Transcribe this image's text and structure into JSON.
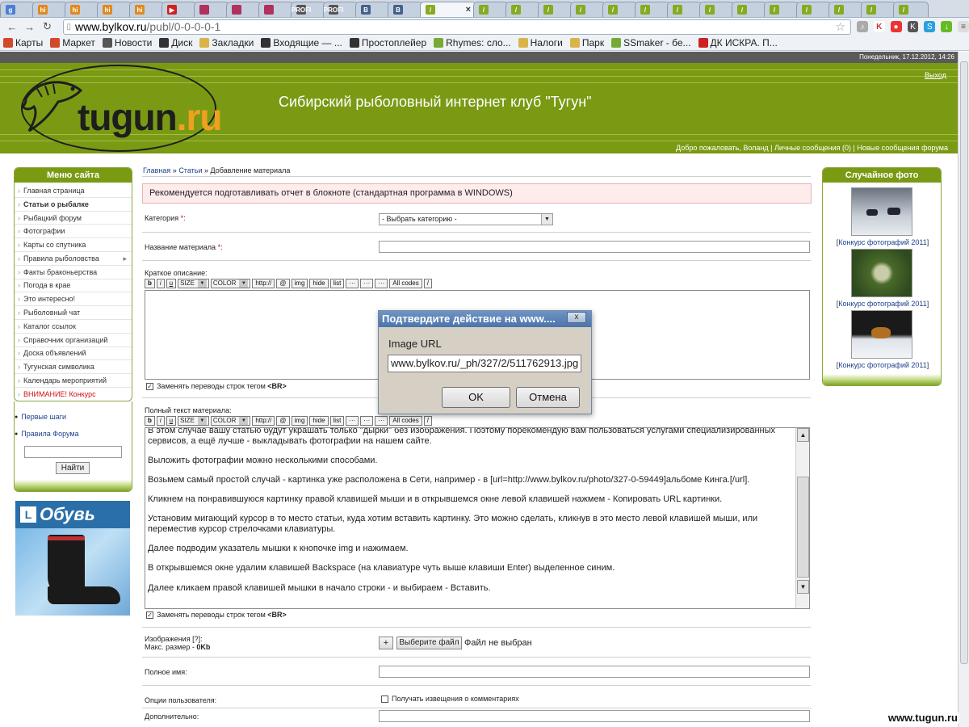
{
  "browser": {
    "tabs": [
      {
        "favicon": "google-icon",
        "label": "g",
        "color": "#4a7fd4"
      },
      {
        "favicon": "hi-icon",
        "label": "hi",
        "color": "#e08a1e"
      },
      {
        "favicon": "hi-icon",
        "label": "hi",
        "color": "#e08a1e"
      },
      {
        "favicon": "hi-icon",
        "label": "hi",
        "color": "#e08a1e"
      },
      {
        "favicon": "hi-icon",
        "label": "hi",
        "color": "#e08a1e"
      },
      {
        "favicon": "youtube-icon",
        "label": "▶",
        "color": "#cc2222"
      },
      {
        "favicon": "page-icon",
        "label": "",
        "color": "#b03060"
      },
      {
        "favicon": "page-icon",
        "label": "",
        "color": "#b03060"
      },
      {
        "favicon": "page-icon",
        "label": "",
        "color": "#b03060"
      },
      {
        "favicon": "profi-icon",
        "label": "PROFI",
        "color": "#555"
      },
      {
        "favicon": "profi-icon",
        "label": "PROFI",
        "color": "#555"
      },
      {
        "favicon": "vk-icon",
        "label": "B",
        "color": "#44618c"
      },
      {
        "favicon": "vk-icon",
        "label": "B",
        "color": "#44618c"
      },
      {
        "favicon": "feather-icon",
        "label": "/",
        "color": "#88aa22",
        "active": true
      },
      {
        "favicon": "feather-icon",
        "label": "/",
        "color": "#88aa22"
      },
      {
        "favicon": "feather-icon",
        "label": "/",
        "color": "#88aa22"
      },
      {
        "favicon": "feather-icon",
        "label": "/",
        "color": "#88aa22"
      },
      {
        "favicon": "feather-icon",
        "label": "/",
        "color": "#88aa22"
      },
      {
        "favicon": "feather-icon",
        "label": "/",
        "color": "#88aa22"
      },
      {
        "favicon": "feather-icon",
        "label": "/",
        "color": "#88aa22"
      },
      {
        "favicon": "feather-icon",
        "label": "/",
        "color": "#88aa22"
      },
      {
        "favicon": "feather-icon",
        "label": "/",
        "color": "#88aa22"
      },
      {
        "favicon": "feather-icon",
        "label": "/",
        "color": "#88aa22"
      },
      {
        "favicon": "feather-icon",
        "label": "/",
        "color": "#88aa22"
      },
      {
        "favicon": "feather-icon",
        "label": "/",
        "color": "#88aa22"
      },
      {
        "favicon": "feather-icon",
        "label": "/",
        "color": "#88aa22"
      },
      {
        "favicon": "feather-icon",
        "label": "/",
        "color": "#88aa22"
      },
      {
        "favicon": "feather-icon",
        "label": "/",
        "color": "#88aa22"
      }
    ],
    "url_domain": "www.bylkov.ru",
    "url_path": "/publ/0-0-0-0-1",
    "bookmarks": [
      {
        "icon": "map-icon",
        "label": "Карты",
        "color": "#d24a2a"
      },
      {
        "icon": "market-icon",
        "label": "Маркет",
        "color": "#d24a2a"
      },
      {
        "icon": "news-icon",
        "label": "Новости",
        "color": "#555"
      },
      {
        "icon": "disk-icon",
        "label": "Диск",
        "color": "#333"
      },
      {
        "icon": "folder-icon",
        "label": "Закладки",
        "color": "#d9b44a"
      },
      {
        "icon": "mail-icon",
        "label": "Входящие — ...",
        "color": "#333"
      },
      {
        "icon": "speaker-icon",
        "label": "Простоплейер",
        "color": "#333"
      },
      {
        "icon": "rhymes-icon",
        "label": "Rhymes: сло...",
        "color": "#7a3"
      },
      {
        "icon": "folder-icon",
        "label": "Налоги",
        "color": "#d9b44a"
      },
      {
        "icon": "folder-icon",
        "label": "Парк",
        "color": "#d9b44a"
      },
      {
        "icon": "ssmaker-icon",
        "label": "SSmaker - бе...",
        "color": "#7a3"
      },
      {
        "icon": "youtube-icon",
        "label": "ДК ИСКРА. П...",
        "color": "#cc2222"
      }
    ]
  },
  "site": {
    "date_line": "Понедельник, 17.12.2012, 14:26",
    "logo_main": "tugun",
    "logo_ru": ".ru",
    "title": "Сибирский рыболовный интернет клуб \"Тугун\"",
    "logout": "Выход",
    "welcome_prefix": "Добро пожаловать,",
    "welcome_user": "Воланд",
    "pm_link": "Личные сообщения (0)",
    "forum_link": "Новые сообщения форума"
  },
  "left_menu": {
    "title": "Меню сайта",
    "items": [
      {
        "label": "Главная страница"
      },
      {
        "label": "Статьи о рыбалке",
        "bold": true
      },
      {
        "label": "Рыбацкий форум"
      },
      {
        "label": "Фотографии"
      },
      {
        "label": "Карты со спутника"
      },
      {
        "label": "Правила рыболовства",
        "arrow": "▸"
      },
      {
        "label": "Факты браконьерства"
      },
      {
        "label": "Погода в крае"
      },
      {
        "label": "Это интересно!"
      },
      {
        "label": "Рыболовный чат"
      },
      {
        "label": "Каталог ссылок"
      },
      {
        "label": "Справочник организаций"
      },
      {
        "label": "Доска объявлений"
      },
      {
        "label": "Тугунская символика"
      },
      {
        "label": "Календарь мероприятий"
      },
      {
        "label": "ВНИМАНИЕ! Конкурс",
        "red": true
      }
    ],
    "first_steps": "Первые шаги",
    "forum_rules": "Правила Форума",
    "search_button": "Найти"
  },
  "ad": {
    "brand": "Обувь",
    "logo_letter": "L"
  },
  "main": {
    "breadcrumb": {
      "home": "Главная",
      "sep": "»",
      "articles": "Статьи",
      "current": "Добавление материала"
    },
    "notice": "Рекомендуется подготавливать отчет в блокноте (стандартная программа в WINDOWS)",
    "category_label": "Категория",
    "category_value": "- Выбрать категорию -",
    "name_label": "Название материала",
    "short_label": "Краткое описание:",
    "toolbar": {
      "b": "b",
      "i": "i",
      "u": "u",
      "size": "SIZE",
      "color": "COLOR",
      "http": "http://",
      "at": "@",
      "img": "img",
      "hide": "hide",
      "list": "list",
      "dots1": "···",
      "dots2": "···",
      "dots3": "···",
      "allcodes": "All codes",
      "slash": "/"
    },
    "br_checkbox": "Заменять переводы строк тегом",
    "br_tag": "<BR>",
    "full_label": "Полный текст материала:",
    "full_text": [
      "В этом случае вашу статью будут украшать только \"дырки\" без изображения. Поэтому порекомендую вам пользоваться услугами специализированных сервисов, а ещё лучше - выкладывать фотографии на нашем сайте.",
      "Выложить фотографии можно несколькими способами.",
      "Возьмем самый простой случай - картинка уже расположена в Сети, например - в [url=http://www.bylkov.ru/photo/327-0-59449]альбоме Кинга.[/url].",
      "Кликнем на понравившуюся картинку правой клавишей мыши и в открывшемся окне левой клавишей нажмем - Копировать URL картинки.",
      "Установим мигающий курсор в то место статьи, куда хотим вставить картинку. Это можно сделать, кликнув в это место левой клавишей мыши, или переместив курсор стрелочками клавиатуры.",
      "Далее подводим указатель мышки к кнопочке img и нажимаем.",
      "В открывшемся окне удалим клавишей Backspace (на клавиатуре чуть выше клавиши Enter) выделенное синим.",
      "Далее кликаем правой клавишей мышки в начало строки - и выбираем - Вставить."
    ],
    "images_label": "Изображения [?]:",
    "max_size_label": "Макс. размер -",
    "max_size_value": "0Kb",
    "plus": "+",
    "choose_file": "Выберите файл",
    "no_file": "Файл не выбран",
    "full_name_label": "Полное имя:",
    "user_options_label": "Опции пользователя:",
    "notify_label": "Получать извещения о комментариях",
    "extra_label": "Дополнительно:",
    "required_mark": "*"
  },
  "right_panel": {
    "title": "Случайное фото",
    "captions": [
      "Конкурс фотографий 2011",
      "Конкурс фотографий 2011",
      "Конкурс фотографий 2011"
    ]
  },
  "dialog": {
    "title": "Подтвердите действие на www....",
    "close": "x",
    "label": "Image URL",
    "value": "www.bylkov.ru/_ph/327/2/511762913.jpg",
    "ok": "OK",
    "cancel": "Отмена"
  },
  "watermark": "www.tugun.ru",
  "colors": {
    "header_green": "#7a9a13",
    "logo_orange": "#f0a020",
    "notice_bg": "#fdeceb",
    "dialog_title": "#4c74aa"
  }
}
